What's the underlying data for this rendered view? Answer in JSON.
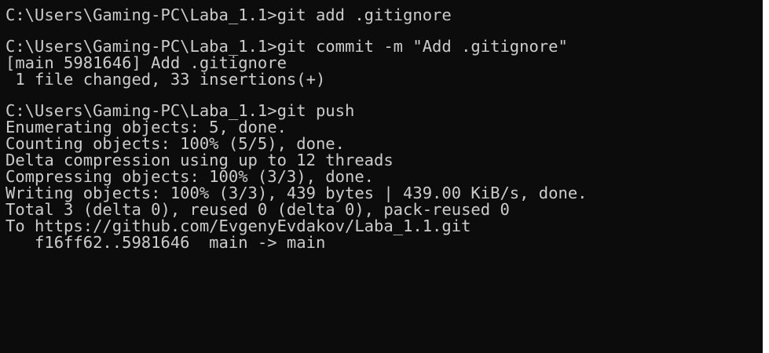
{
  "console": {
    "lines": [
      "C:\\Users\\Gaming-PC\\Laba_1.1>git add .gitignore",
      "C:\\Users\\Gaming-PC\\Laba_1.1>git commit -m \"Add .gitignore\"",
      "[main 5981646] Add .gitignore",
      " 1 file changed, 33 insertions(+)",
      "C:\\Users\\Gaming-PC\\Laba_1.1>git push",
      "Enumerating objects: 5, done.",
      "Counting objects: 100% (5/5), done.",
      "Delta compression using up to 12 threads",
      "Compressing objects: 100% (3/3), done.",
      "Writing objects: 100% (3/3), 439 bytes | 439.00 KiB/s, done.",
      "Total 3 (delta 0), reused 0 (delta 0), pack-reused 0",
      "To https://github.com/EvgenyEvdakov/Laba_1.1.git",
      "   f16ff62..5981646  main -> main"
    ],
    "colors": {
      "background": "#0c0c0c",
      "foreground": "#cccccc"
    }
  }
}
